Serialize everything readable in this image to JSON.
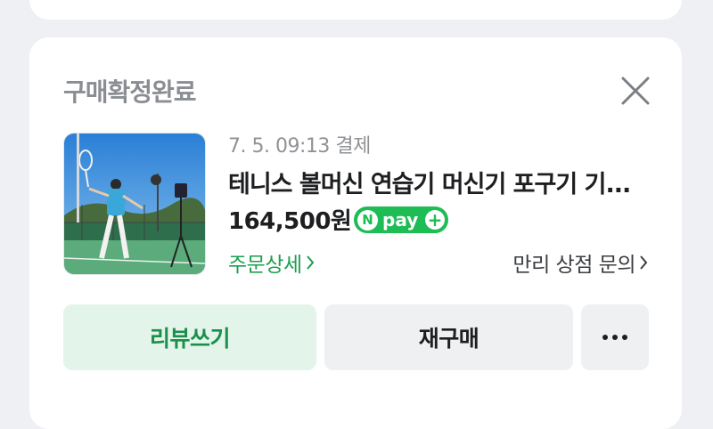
{
  "order": {
    "status": "구매확정완료",
    "date": "7. 5. 09:13 결제",
    "product_title": "테니스 볼머신 연습기 머신기 포구기 기...",
    "price": "164,500원",
    "payment_badge": {
      "n": "N",
      "word": "pay",
      "plus": "+"
    },
    "order_detail_link": "주문상세",
    "store_inquiry_link": "만리 상점 문의",
    "icons": {
      "close": "close-icon",
      "chevron": "chevron-right-icon",
      "more": "more-dots-icon"
    }
  },
  "actions": {
    "review": "리뷰쓰기",
    "rebuy": "재구매"
  },
  "colors": {
    "accent_green": "#1c9e50",
    "npay_green": "#1ebc54",
    "review_bg": "#e3f5ea",
    "muted_text": "#8a8d92",
    "background": "#eef0f3"
  }
}
